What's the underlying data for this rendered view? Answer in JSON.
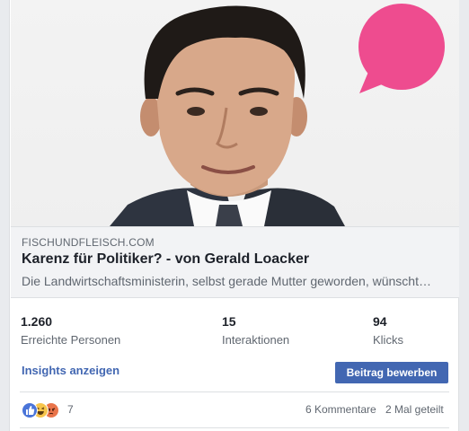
{
  "link_preview": {
    "domain": "FISCHUNDFLEISCH.COM",
    "title": "Karenz für Politiker? - von Gerald Loacker",
    "description": "Die Landwirtschaftsministerin, selbst gerade Mutter geworden, wünscht…"
  },
  "stats": [
    {
      "value": "1.260",
      "label": "Erreichte Personen"
    },
    {
      "value": "15",
      "label": "Interaktionen"
    },
    {
      "value": "94",
      "label": "Klicks"
    }
  ],
  "actions": {
    "insights": "Insights anzeigen",
    "promote": "Beitrag bewerben"
  },
  "engagement": {
    "reaction_icons": [
      "like-icon",
      "haha-icon",
      "angry-icon"
    ],
    "reaction_count": "7",
    "comments": "6 Kommentare",
    "shares": "2 Mal geteilt"
  },
  "colors": {
    "accent": "#4267b2",
    "speech_bubble": "#ee4c8f",
    "preview_bg": "#f2f3f5"
  }
}
